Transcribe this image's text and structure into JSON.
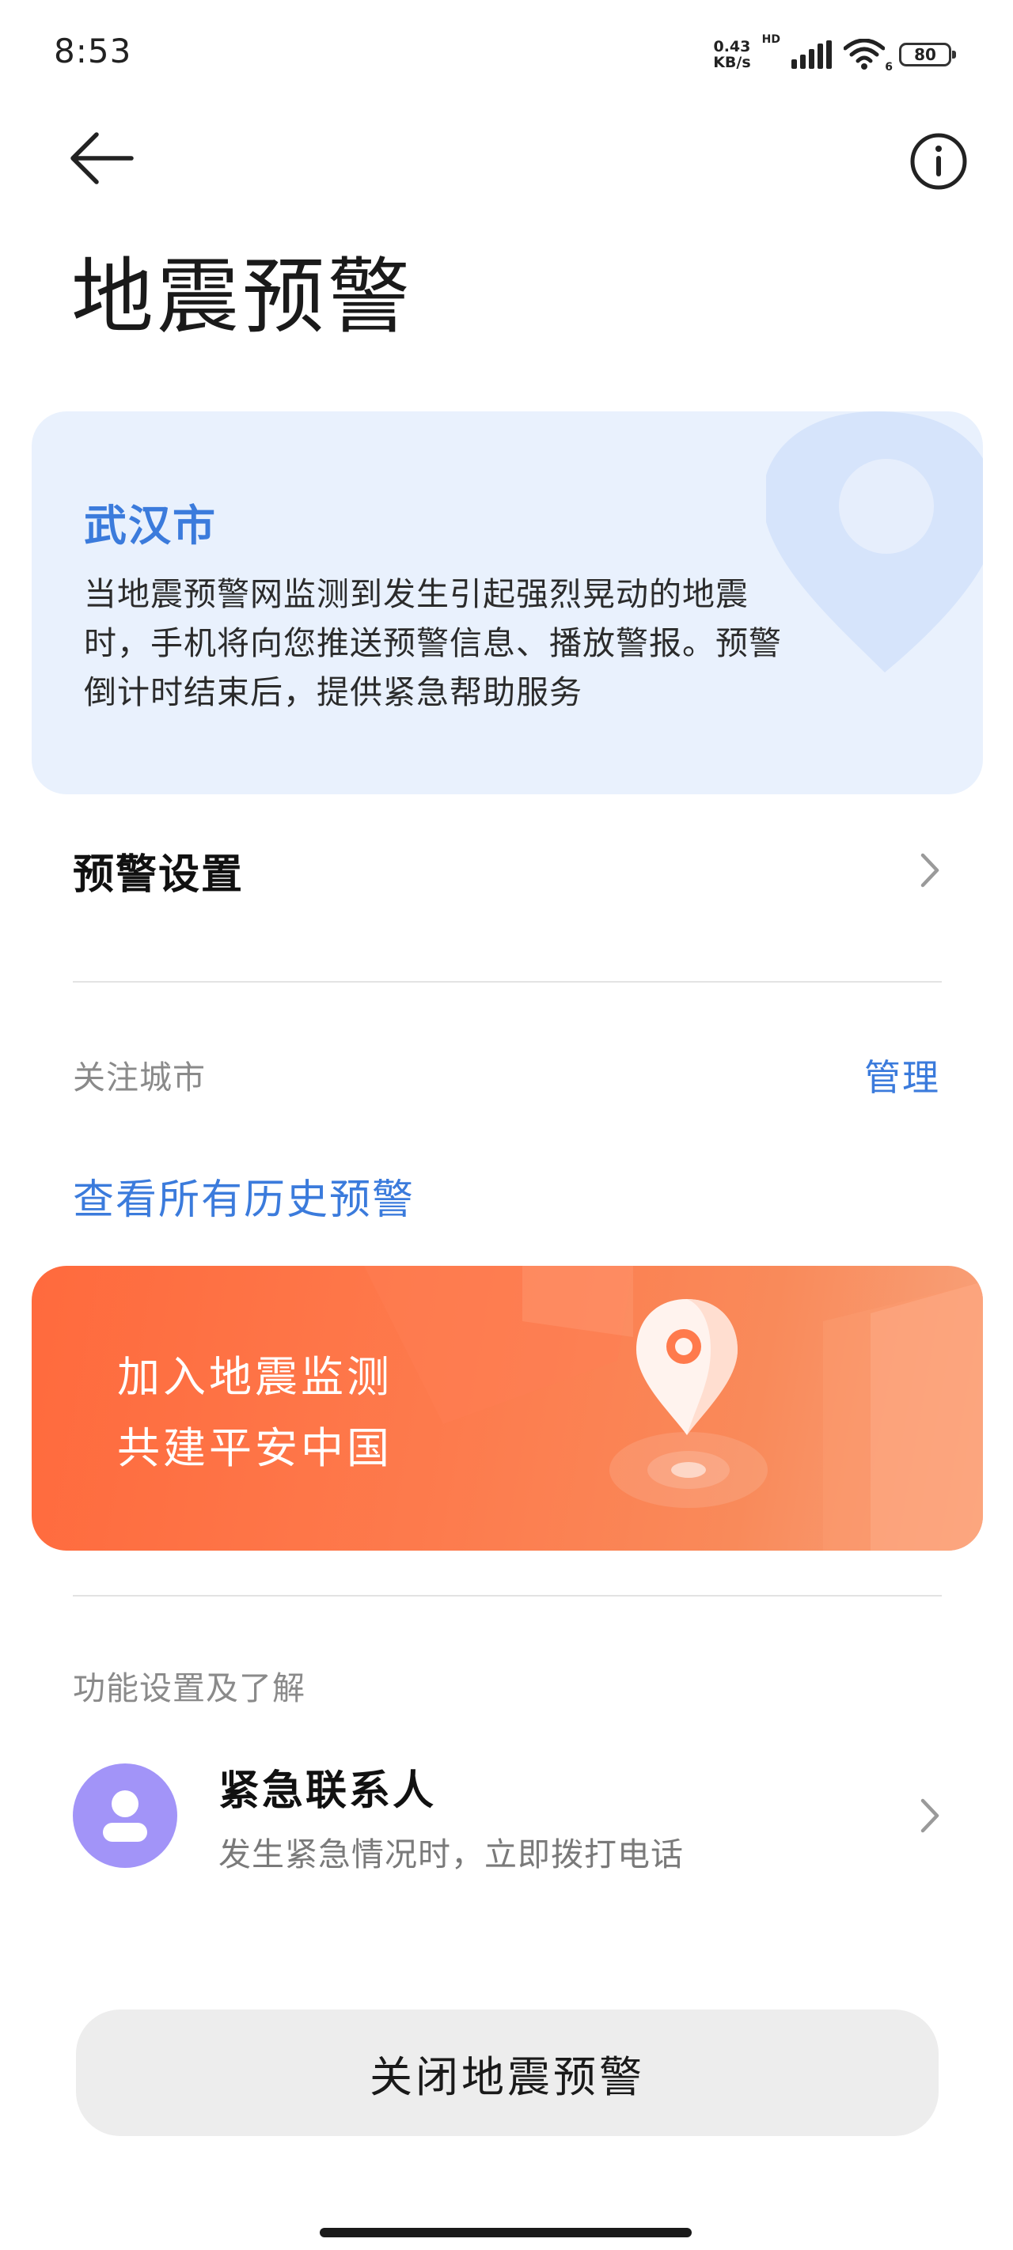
{
  "status_bar": {
    "time": "8:53",
    "net_speed_value": "0.43",
    "net_speed_unit": "KB/s",
    "hd": "HD",
    "wifi_sub": "6",
    "battery": "80"
  },
  "header": {
    "title": "地震预警",
    "back_icon": "arrow-left-icon",
    "info_icon": "info-circle-icon"
  },
  "info_card": {
    "city": "武汉市",
    "description": "当地震预警网监测到发生引起强烈晃动的地震时，手机将向您推送预警信息、播放警报。预警倒计时结束后，提供紧急帮助服务",
    "bg_color": "#e9f1fd",
    "accent_color": "#3b7bdc"
  },
  "settings": {
    "warning_settings_label": "预警设置"
  },
  "followed_cities": {
    "label": "关注城市",
    "manage_label": "管理"
  },
  "history_link": "查看所有历史预警",
  "banner": {
    "line1": "加入地震监测",
    "line2": "共建平安中国",
    "color": "#ff6a3d"
  },
  "features": {
    "section_label": "功能设置及了解",
    "emergency_contact": {
      "title": "紧急联系人",
      "subtitle": "发生紧急情况时，立即拨打电话",
      "avatar_color": "#a294f8"
    }
  },
  "close_button_label": "关闭地震预警"
}
